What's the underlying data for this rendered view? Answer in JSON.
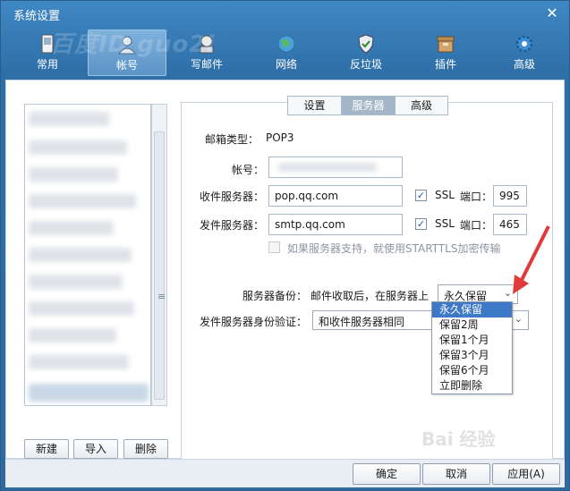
{
  "window": {
    "title": "系统设置",
    "close_symbol": "✕"
  },
  "watermark": {
    "text": "百度ID guo2i"
  },
  "toolbar": {
    "items": [
      {
        "label": "常用",
        "icon": "phone-icon"
      },
      {
        "label": "帐号",
        "icon": "user-icon"
      },
      {
        "label": "写邮件",
        "icon": "write-mail-icon"
      },
      {
        "label": "网络",
        "icon": "globe-icon"
      },
      {
        "label": "反垃圾",
        "icon": "shield-icon"
      },
      {
        "label": "插件",
        "icon": "plugin-box-icon"
      },
      {
        "label": "高级",
        "icon": "gear-icon"
      }
    ],
    "active_index": 1
  },
  "left": {
    "buttons": {
      "new": "新建",
      "import": "导入",
      "delete": "删除"
    }
  },
  "tabs": [
    {
      "label": "设置"
    },
    {
      "label": "服务器"
    },
    {
      "label": "高级"
    }
  ],
  "form": {
    "mailbox_type_label": "邮箱类型：",
    "mailbox_type_value": "POP3",
    "account_label": "帐号：",
    "account_value": "",
    "incoming_label": "收件服务器：",
    "incoming_value": "pop.qq.com",
    "incoming_ssl": "SSL",
    "incoming_port_label": "端口：",
    "incoming_port": "995",
    "outgoing_label": "发件服务器：",
    "outgoing_value": "smtp.qq.com",
    "outgoing_ssl": "SSL",
    "outgoing_port_label": "端口：",
    "outgoing_port": "465",
    "starttls_text": "如果服务器支持，就使用STARTTLS加密传输",
    "backup_label": "服务器备份：",
    "backup_desc": "邮件收取后，在服务器上",
    "backup_selected": "永久保留",
    "auth_label": "发件服务器身份验证：",
    "auth_selected": "和收件服务器相同"
  },
  "dropdown": {
    "options": [
      "永久保留",
      "保留2周",
      "保留1个月",
      "保留3个月",
      "保留6个月",
      "立即删除"
    ],
    "highlighted_index": 0
  },
  "footer": {
    "ok": "确定",
    "cancel": "取消",
    "apply": "应用(A)"
  },
  "baidu_watermark": "Bai 经验",
  "colors": {
    "title_bar": "#3f88c4",
    "selection": "#3d79c6",
    "annotation_arrow": "#e03a3a"
  }
}
